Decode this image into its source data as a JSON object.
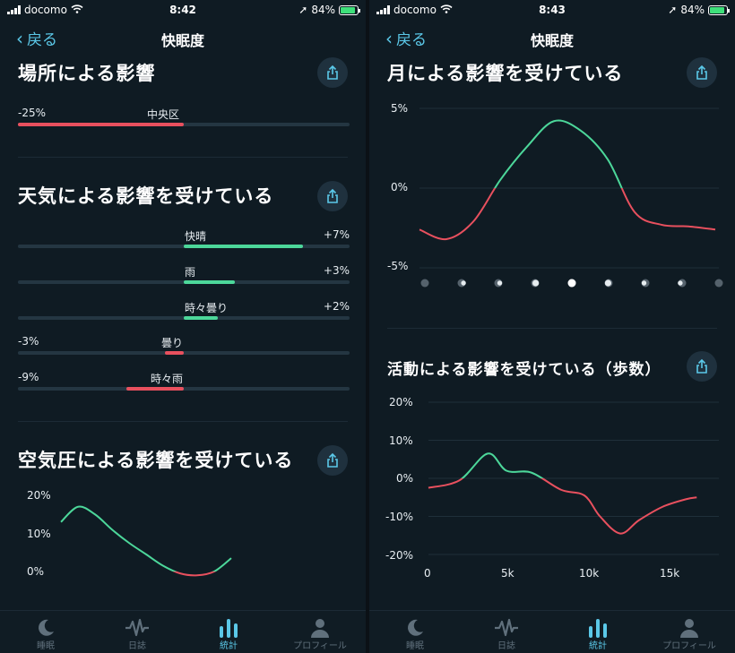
{
  "status_left": {
    "carrier": "docomo",
    "time": "8:42",
    "battery": "84%"
  },
  "status_right": {
    "carrier": "docomo",
    "time": "8:43",
    "battery": "84%"
  },
  "nav": {
    "back_label": "戻る",
    "title": "快眠度"
  },
  "colors": {
    "positive": "#4cd79a",
    "negative": "#e8505e",
    "accent": "#5bc8e8",
    "background": "#0f1b23"
  },
  "location": {
    "title": "場所による影響",
    "items": [
      {
        "name": "中央区",
        "value_label": "-25%",
        "value": -25
      }
    ]
  },
  "weather": {
    "title": "天気による影響を受けている",
    "items": [
      {
        "name": "快晴",
        "value_label": "+7%",
        "value": 7
      },
      {
        "name": "雨",
        "value_label": "+3%",
        "value": 3
      },
      {
        "name": "時々曇り",
        "value_label": "+2%",
        "value": 2
      },
      {
        "name": "曇り",
        "value_label": "-3%",
        "value": -3
      },
      {
        "name": "時々雨",
        "value_label": "-9%",
        "value": -9
      }
    ]
  },
  "pressure": {
    "title": "空気圧による影響を受けている",
    "y_ticks": [
      "20%",
      "10%",
      "0%"
    ]
  },
  "moon": {
    "title": "月による影響を受けている",
    "y_ticks": [
      "5%",
      "0%",
      "-5%"
    ],
    "phases": [
      "new-moon-icon",
      "waxing-crescent-icon",
      "first-quarter-icon",
      "waxing-gibbous-icon",
      "full-moon-icon",
      "waning-gibbous-icon",
      "last-quarter-icon",
      "waning-crescent-icon",
      "new-moon-icon"
    ]
  },
  "activity": {
    "title": "活動による影響を受けている（歩数）",
    "y_ticks": [
      "20%",
      "10%",
      "0%",
      "-10%",
      "-20%"
    ],
    "x_ticks": [
      "0",
      "5k",
      "10k",
      "15k"
    ]
  },
  "tabs": [
    {
      "label": "睡眠",
      "icon": "moon-icon"
    },
    {
      "label": "日誌",
      "icon": "waveform-icon"
    },
    {
      "label": "統計",
      "icon": "bar-chart-icon"
    },
    {
      "label": "プロフィール",
      "icon": "person-icon"
    }
  ],
  "active_tab": "統計",
  "chart_data": [
    {
      "type": "line",
      "title": "空気圧による影響を受けている",
      "ylim": [
        -2,
        22
      ],
      "y_ticks": [
        "20%",
        "10%",
        "0%"
      ],
      "x": [
        0,
        1,
        2,
        3,
        4,
        5,
        6,
        7,
        8,
        9,
        10
      ],
      "values": [
        13,
        17,
        15,
        11,
        7.5,
        4.5,
        1.5,
        -0.5,
        -1,
        0,
        3.5
      ]
    },
    {
      "type": "line",
      "title": "月による影響を受けている",
      "ylim": [
        -5,
        5
      ],
      "y_ticks": [
        "5%",
        "0%",
        "-5%"
      ],
      "x": [
        0,
        1,
        2,
        3,
        4,
        5,
        6,
        7,
        8,
        9,
        10,
        11
      ],
      "values": [
        -2.6,
        -3.2,
        -2.1,
        0.5,
        2.6,
        4.2,
        3.6,
        1.8,
        -1.5,
        -2.3,
        -2.4,
        -2.6
      ]
    },
    {
      "type": "line",
      "title": "活動による影響を受けている（歩数）",
      "xlim": [
        0,
        18000
      ],
      "ylim": [
        -20,
        20
      ],
      "x_ticks": [
        "0",
        "5k",
        "10k",
        "15k"
      ],
      "y_ticks": [
        "20%",
        "10%",
        "0%",
        "-10%",
        "-20%"
      ],
      "x": [
        0,
        2000,
        3800,
        5000,
        6600,
        8500,
        10000,
        11000,
        12300,
        13500,
        15000,
        16500,
        17200
      ],
      "values": [
        -2.5,
        -0.5,
        6.5,
        2,
        1.5,
        -3,
        -4.5,
        -10,
        -14.5,
        -11,
        -7.5,
        -5.5,
        -5
      ]
    }
  ]
}
